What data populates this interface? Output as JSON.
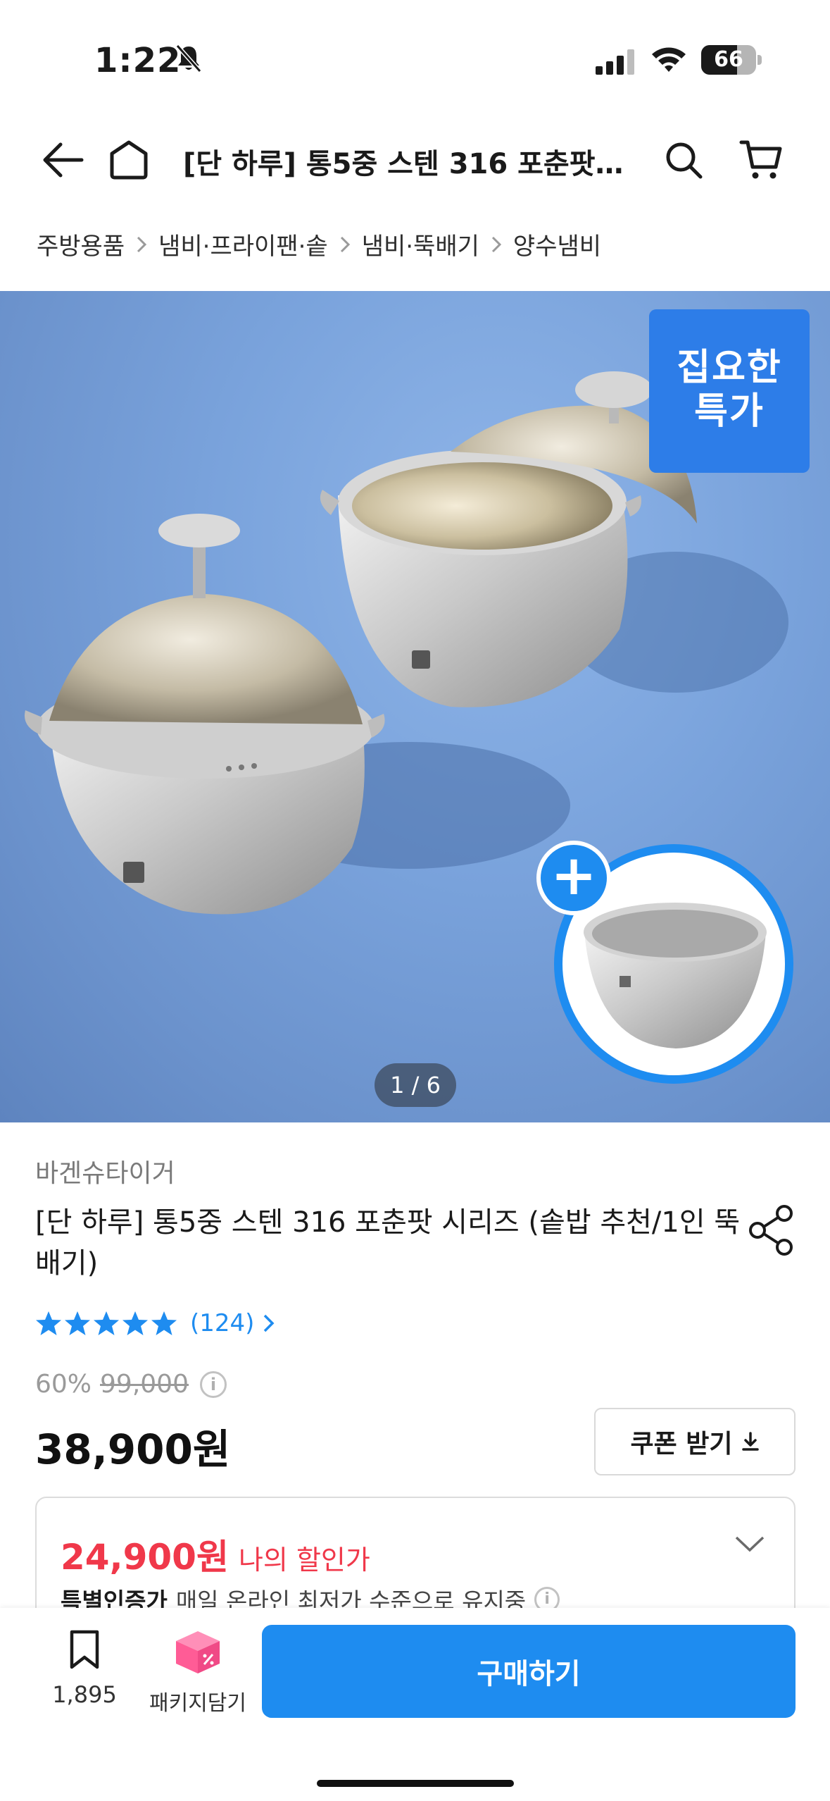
{
  "status_bar": {
    "time": "1:22",
    "battery": "66",
    "battery_level": 0.66
  },
  "header": {
    "title": "[단 하루] 통5중 스텐 316 포춘팟…"
  },
  "breadcrumb": [
    "주방용품",
    "냄비·프라이팬·솥",
    "냄비·뚝배기",
    "양수냄비"
  ],
  "hero": {
    "badge_line1": "집요한",
    "badge_line2": "특가",
    "counter": "1 / 6",
    "plus": "+"
  },
  "product": {
    "brand": "바겐슈타이거",
    "title": "[단 하루] 통5중 스텐 316 포춘팟 시리즈 (솥밥 추천/1인 뚝배기)",
    "rating_stars": 5,
    "review_count": "(124)",
    "discount": "60%",
    "original_price": "99,000",
    "price": "38,900원",
    "coupon_label": "쿠폰 받기"
  },
  "my_price": {
    "value": "24,900원",
    "label": "나의 할인가",
    "cert_strong": "특별인증가",
    "cert_text": "매일 온라인 최저가 수준으로 유지중"
  },
  "bottom_bar": {
    "bookmark_count": "1,895",
    "package_label": "패키지담기",
    "buy_label": "구매하기"
  },
  "colors": {
    "accent": "#1e8cf0",
    "sale_red": "#f0384a",
    "badge_blue": "#2d7de8"
  }
}
